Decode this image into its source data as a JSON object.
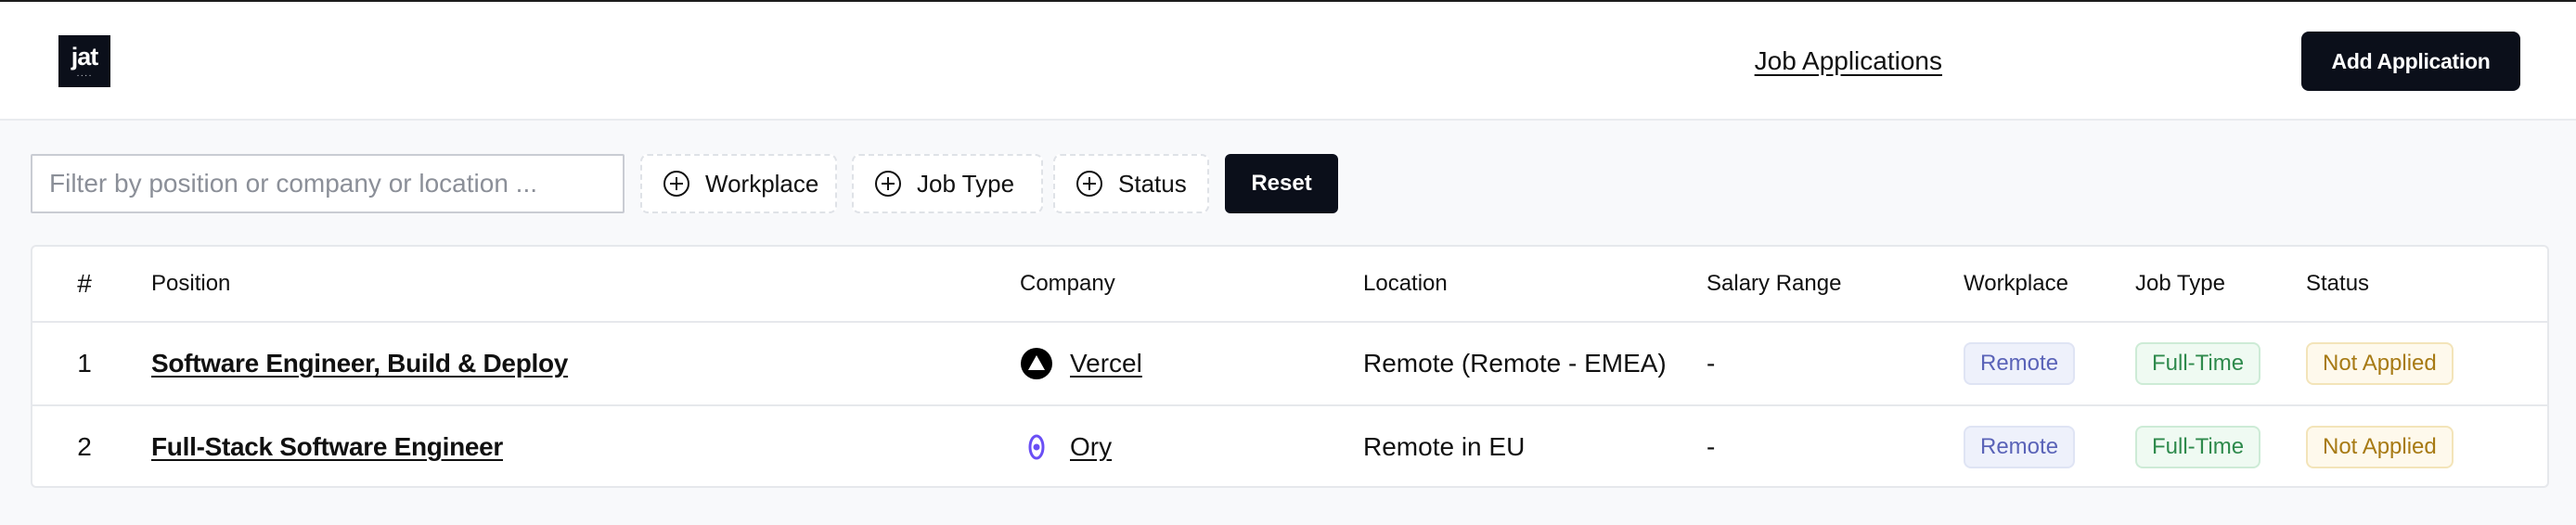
{
  "app": {
    "logo_text": "jat",
    "logo_dots": "····"
  },
  "header": {
    "nav_link": "Job Applications",
    "add_button": "Add Application"
  },
  "filters": {
    "search_placeholder": "Filter by position or company or location ...",
    "search_value": "",
    "chips": [
      "Workplace",
      "Job Type",
      "Status"
    ],
    "reset_label": "Reset"
  },
  "table": {
    "columns": [
      "#",
      "Position",
      "Company",
      "Location",
      "Salary Range",
      "Workplace",
      "Job Type",
      "Status"
    ],
    "rows": [
      {
        "num": "1",
        "position": "Software Engineer, Build & Deploy",
        "company": "Vercel",
        "company_icon": "vercel-logo-icon",
        "location": "Remote (Remote - EMEA)",
        "salary": "-",
        "workplace": "Remote",
        "job_type": "Full-Time",
        "status": "Not Applied"
      },
      {
        "num": "2",
        "position": "Full-Stack Software Engineer",
        "company": "Ory",
        "company_icon": "ory-logo-icon",
        "location": "Remote in EU",
        "salary": "-",
        "workplace": "Remote",
        "job_type": "Full-Time",
        "status": "Not Applied"
      }
    ]
  },
  "colors": {
    "primary": "#0b0f1a",
    "page_bg": "#f8f9fb",
    "badge_remote": "#5a63b8",
    "badge_fulltime": "#2e8a4c",
    "badge_not_applied": "#a77a14",
    "ory_purple": "#6a4ff5"
  }
}
